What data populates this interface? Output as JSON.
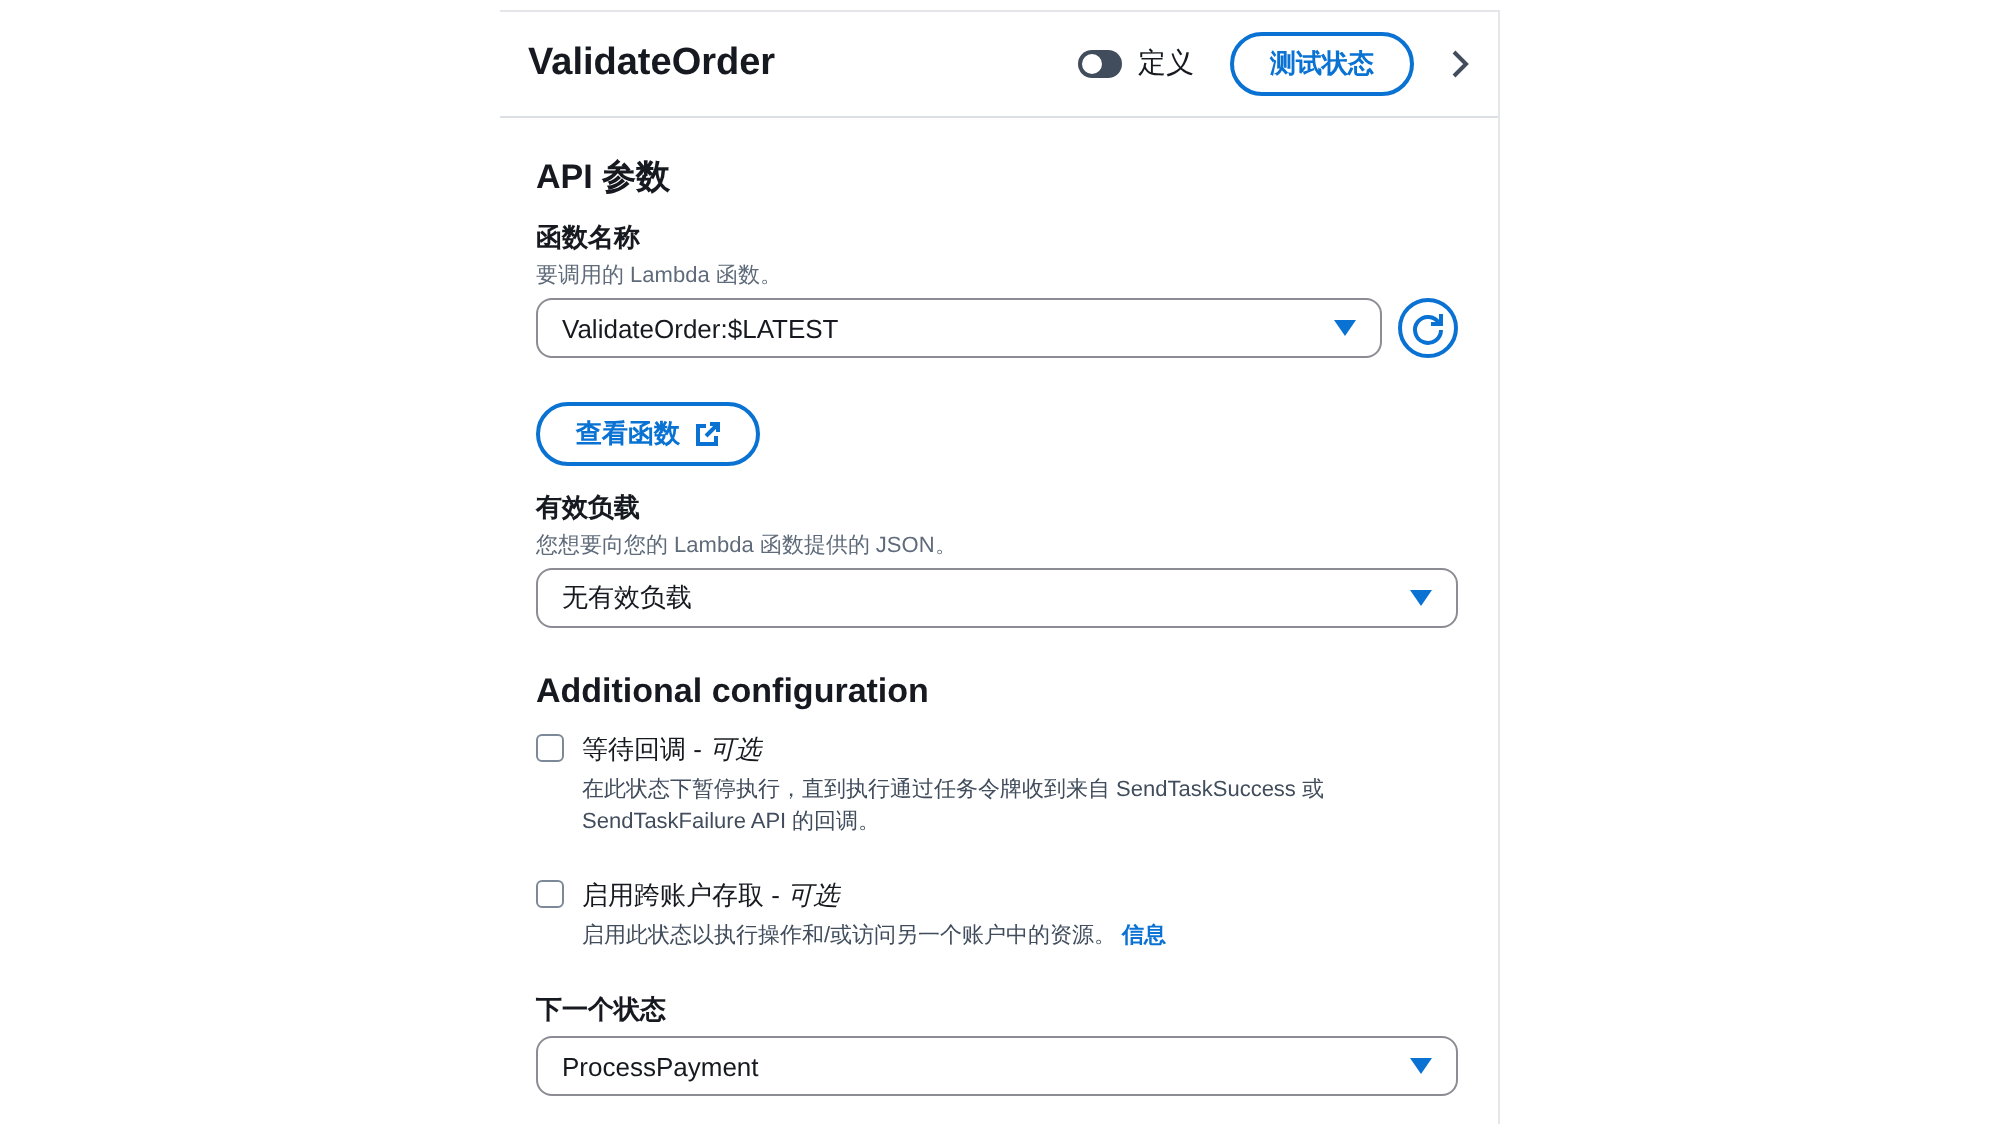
{
  "header": {
    "title": "ValidateOrder",
    "toggle": {
      "label": "定义",
      "on": false
    },
    "test_button": "测试状态"
  },
  "api_section": {
    "title": "API 参数",
    "function_name": {
      "label": "函数名称",
      "description": "要调用的 Lambda 函数。",
      "value": "ValidateOrder:$LATEST"
    },
    "view_button": "查看函数",
    "payload": {
      "label": "有效负载",
      "description": "您想要向您的 Lambda 函数提供的 JSON。",
      "value": "无有效负载"
    }
  },
  "additional": {
    "title": "Additional configuration",
    "options": [
      {
        "label": "等待回调 -",
        "optional": "可选",
        "checked": false,
        "description": "在此状态下暂停执行，直到执行通过任务令牌收到来自 SendTaskSuccess 或 SendTaskFailure API 的回调。"
      },
      {
        "label": "启用跨账户存取 -",
        "optional": "可选",
        "checked": false,
        "description": "启用此状态以执行操作和/或访问另一个账户中的资源。",
        "link": "信息"
      }
    ]
  },
  "next_state": {
    "label": "下一个状态",
    "value": "ProcessPayment"
  }
}
